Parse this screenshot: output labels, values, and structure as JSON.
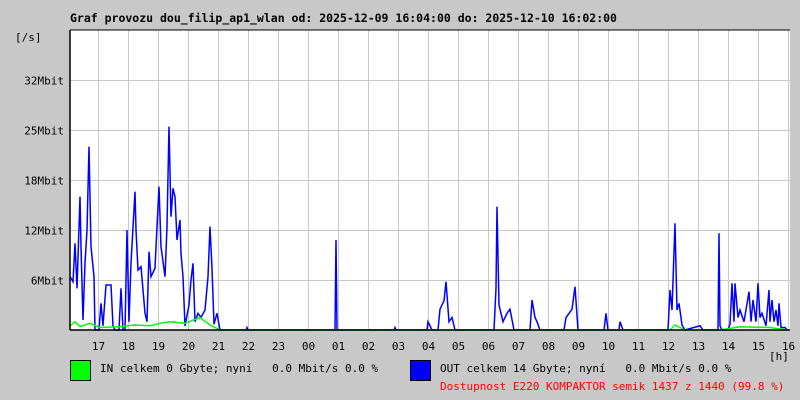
{
  "chart_data": {
    "type": "line",
    "title": "Graf provozu dou_filip_ap1_wlan od: 2025-12-09 16:04:00 do: 2025-12-10 16:02:00",
    "ylabel": "[/s]",
    "xlabel": "[h]",
    "x_units": "minutes since 2025-12-09 16:04",
    "xlim": [
      0,
      1440
    ],
    "ylim": [
      0,
      36
    ],
    "grid": true,
    "y_ticks": [
      {
        "value": 6,
        "label": "6Mbit"
      },
      {
        "value": 12,
        "label": "12Mbit"
      },
      {
        "value": 18,
        "label": "18Mbit"
      },
      {
        "value": 24,
        "label": "25Mbit"
      },
      {
        "value": 30,
        "label": "32Mbit"
      }
    ],
    "x_ticks": [
      {
        "value": 56,
        "label": "17"
      },
      {
        "value": 116,
        "label": "18"
      },
      {
        "value": 176,
        "label": "19"
      },
      {
        "value": 236,
        "label": "20"
      },
      {
        "value": 296,
        "label": "21"
      },
      {
        "value": 356,
        "label": "22"
      },
      {
        "value": 416,
        "label": "23"
      },
      {
        "value": 476,
        "label": "00"
      },
      {
        "value": 536,
        "label": "01"
      },
      {
        "value": 596,
        "label": "02"
      },
      {
        "value": 656,
        "label": "03"
      },
      {
        "value": 716,
        "label": "04"
      },
      {
        "value": 776,
        "label": "05"
      },
      {
        "value": 836,
        "label": "06"
      },
      {
        "value": 896,
        "label": "07"
      },
      {
        "value": 956,
        "label": "08"
      },
      {
        "value": 1016,
        "label": "09"
      },
      {
        "value": 1076,
        "label": "10"
      },
      {
        "value": 1136,
        "label": "11"
      },
      {
        "value": 1196,
        "label": "12"
      },
      {
        "value": 1256,
        "label": "13"
      },
      {
        "value": 1316,
        "label": "14"
      },
      {
        "value": 1376,
        "label": "15"
      },
      {
        "value": 1436,
        "label": "16"
      }
    ],
    "series": [
      {
        "name": "OUT",
        "color": "#0000ff",
        "points": [
          [
            0,
            6.4
          ],
          [
            6,
            5.8
          ],
          [
            10,
            10.4
          ],
          [
            14,
            5
          ],
          [
            20,
            16
          ],
          [
            22,
            10
          ],
          [
            26,
            1.2
          ],
          [
            30,
            8
          ],
          [
            34,
            12
          ],
          [
            38,
            22
          ],
          [
            42,
            10
          ],
          [
            48,
            6.4
          ],
          [
            50,
            0
          ],
          [
            58,
            0
          ],
          [
            62,
            3.2
          ],
          [
            66,
            0.5
          ],
          [
            72,
            5.4
          ],
          [
            82,
            5.4
          ],
          [
            86,
            0.5
          ],
          [
            90,
            0
          ],
          [
            98,
            0
          ],
          [
            102,
            5
          ],
          [
            106,
            0
          ],
          [
            110,
            0
          ],
          [
            114,
            12
          ],
          [
            118,
            1
          ],
          [
            122,
            8
          ],
          [
            130,
            16.6
          ],
          [
            132,
            12
          ],
          [
            136,
            7.2
          ],
          [
            142,
            7.6
          ],
          [
            150,
            2
          ],
          [
            154,
            1
          ],
          [
            158,
            9.4
          ],
          [
            162,
            6.4
          ],
          [
            170,
            7.4
          ],
          [
            174,
            12.4
          ],
          [
            178,
            17.2
          ],
          [
            182,
            10
          ],
          [
            190,
            6.4
          ],
          [
            194,
            12.4
          ],
          [
            198,
            24.4
          ],
          [
            202,
            13.6
          ],
          [
            206,
            17
          ],
          [
            210,
            16
          ],
          [
            214,
            10.8
          ],
          [
            220,
            13.2
          ],
          [
            222,
            9.2
          ],
          [
            226,
            6.4
          ],
          [
            230,
            0.5
          ],
          [
            238,
            3
          ],
          [
            242,
            6
          ],
          [
            246,
            8
          ],
          [
            250,
            1
          ],
          [
            256,
            2
          ],
          [
            262,
            1.5
          ],
          [
            270,
            2.4
          ],
          [
            276,
            6.4
          ],
          [
            280,
            12.4
          ],
          [
            284,
            7.4
          ],
          [
            288,
            0.7
          ],
          [
            294,
            2
          ],
          [
            300,
            0
          ],
          [
            352,
            0
          ],
          [
            354,
            0.3
          ],
          [
            356,
            0
          ],
          [
            530,
            0
          ],
          [
            532,
            10.8
          ],
          [
            534,
            0
          ],
          [
            648,
            0
          ],
          [
            650,
            0.3
          ],
          [
            652,
            0
          ],
          [
            714,
            0
          ],
          [
            716,
            1
          ],
          [
            724,
            0
          ],
          [
            736,
            0
          ],
          [
            740,
            2.5
          ],
          [
            748,
            3.5
          ],
          [
            752,
            5.8
          ],
          [
            758,
            1
          ],
          [
            764,
            1.5
          ],
          [
            770,
            0
          ],
          [
            848,
            0
          ],
          [
            852,
            5
          ],
          [
            854,
            14.8
          ],
          [
            858,
            3
          ],
          [
            866,
            1
          ],
          [
            874,
            2
          ],
          [
            880,
            2.5
          ],
          [
            888,
            0
          ],
          [
            920,
            0
          ],
          [
            924,
            3.6
          ],
          [
            930,
            1.5
          ],
          [
            934,
            1
          ],
          [
            940,
            0
          ],
          [
            988,
            0
          ],
          [
            992,
            1.5
          ],
          [
            1004,
            2.5
          ],
          [
            1010,
            5.2
          ],
          [
            1016,
            0
          ],
          [
            1068,
            0
          ],
          [
            1072,
            2
          ],
          [
            1076,
            0
          ],
          [
            1098,
            0
          ],
          [
            1100,
            1
          ],
          [
            1106,
            0
          ],
          [
            1196,
            0
          ],
          [
            1200,
            4.8
          ],
          [
            1204,
            2.4
          ],
          [
            1210,
            12.8
          ],
          [
            1214,
            2.4
          ],
          [
            1218,
            3.2
          ],
          [
            1224,
            0.6
          ],
          [
            1230,
            0
          ],
          [
            1260,
            0.5
          ],
          [
            1266,
            0
          ],
          [
            1296,
            0
          ],
          [
            1298,
            11.6
          ],
          [
            1300,
            0.5
          ],
          [
            1304,
            0
          ],
          [
            1316,
            0
          ],
          [
            1320,
            0.7
          ],
          [
            1324,
            5.6
          ],
          [
            1328,
            1
          ],
          [
            1330,
            5.6
          ],
          [
            1336,
            1.5
          ],
          [
            1340,
            2.4
          ],
          [
            1348,
            1
          ],
          [
            1358,
            4.6
          ],
          [
            1362,
            1
          ],
          [
            1366,
            3.6
          ],
          [
            1372,
            1
          ],
          [
            1376,
            5.6
          ],
          [
            1380,
            1.5
          ],
          [
            1384,
            2
          ],
          [
            1392,
            0.5
          ],
          [
            1398,
            4.8
          ],
          [
            1400,
            1
          ],
          [
            1404,
            3.6
          ],
          [
            1408,
            1
          ],
          [
            1412,
            2.4
          ],
          [
            1416,
            0.5
          ],
          [
            1418,
            3.2
          ],
          [
            1422,
            0.3
          ],
          [
            1430,
            0.3
          ],
          [
            1434,
            0
          ]
        ]
      },
      {
        "name": "IN",
        "color": "#00ff00",
        "points": [
          [
            0,
            0.5
          ],
          [
            10,
            1
          ],
          [
            20,
            0.4
          ],
          [
            40,
            0.8
          ],
          [
            60,
            0.3
          ],
          [
            100,
            0.4
          ],
          [
            130,
            0.6
          ],
          [
            160,
            0.5
          ],
          [
            180,
            0.8
          ],
          [
            200,
            1
          ],
          [
            230,
            0.8
          ],
          [
            260,
            1.5
          ],
          [
            280,
            0.6
          ],
          [
            300,
            0
          ],
          [
            1200,
            0
          ],
          [
            1210,
            0.6
          ],
          [
            1230,
            0
          ],
          [
            1300,
            0
          ],
          [
            1340,
            0.4
          ],
          [
            1400,
            0.3
          ],
          [
            1434,
            0
          ]
        ]
      }
    ]
  },
  "legend": {
    "in": {
      "label": "IN celkem 0 Gbyte; nyní   0.0 Mbit/s 0.0 %",
      "color": "#00ff00"
    },
    "out": {
      "label": "OUT celkem 14 Gbyte; nyní   0.0 Mbit/s 0.0 %",
      "color": "#0000ff"
    },
    "availability": {
      "label": "Dostupnost E220 KOMPAKTOR semik 1437 z 1440 (99.8 %)",
      "color": "#ff0000"
    }
  }
}
